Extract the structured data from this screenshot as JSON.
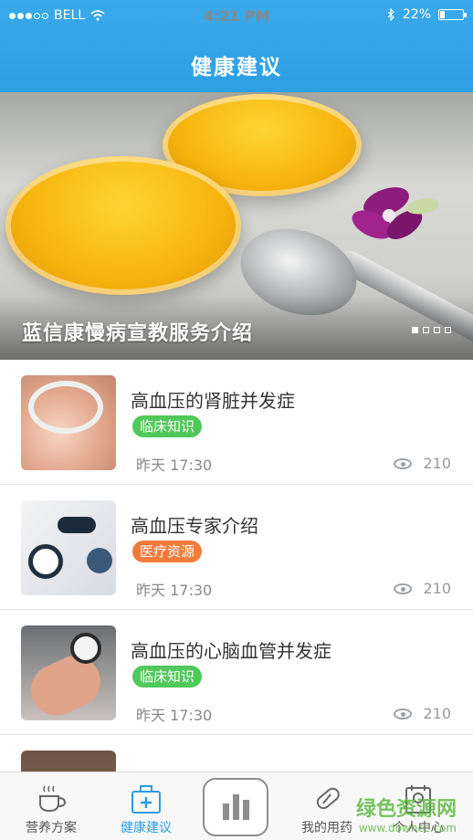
{
  "status_bar": {
    "carrier": "BELL",
    "time": "4:21 PM",
    "battery": "22%",
    "battery_level": 0.22
  },
  "header": {
    "title": "健康建议"
  },
  "banner": {
    "caption": "蓝信康慢病宣教服务介绍",
    "pages": 4,
    "active_page": 1
  },
  "articles": [
    {
      "title": "高血压的肾脏并发症",
      "tag": "临床知识",
      "tag_color": "#50c85a",
      "time": "昨天 17:30",
      "views": "210"
    },
    {
      "title": "高血压专家介绍",
      "tag": "医疗资源",
      "tag_color": "#f37b3a",
      "time": "昨天 17:30",
      "views": "210"
    },
    {
      "title": "高血压的心脑血管并发症",
      "tag": "临床知识",
      "tag_color": "#50c85a",
      "time": "昨天 17:30",
      "views": "210"
    }
  ],
  "tabbar": {
    "items": [
      {
        "label": "营养方案",
        "icon": "cup-icon"
      },
      {
        "label": "健康建议",
        "icon": "medical-kit-icon",
        "active": true
      },
      {
        "label": "",
        "icon": "bar-chart-icon"
      },
      {
        "label": "我的用药",
        "icon": "pill-icon"
      },
      {
        "label": "个人中心",
        "icon": "profile-icon"
      }
    ]
  },
  "watermark": {
    "text": "绿色资源网",
    "url": "www.downcc.com"
  },
  "colors": {
    "header": "#39a9ea",
    "accent": "#2b9de3",
    "green_tag": "#50c85a",
    "orange_tag": "#f37b3a"
  }
}
